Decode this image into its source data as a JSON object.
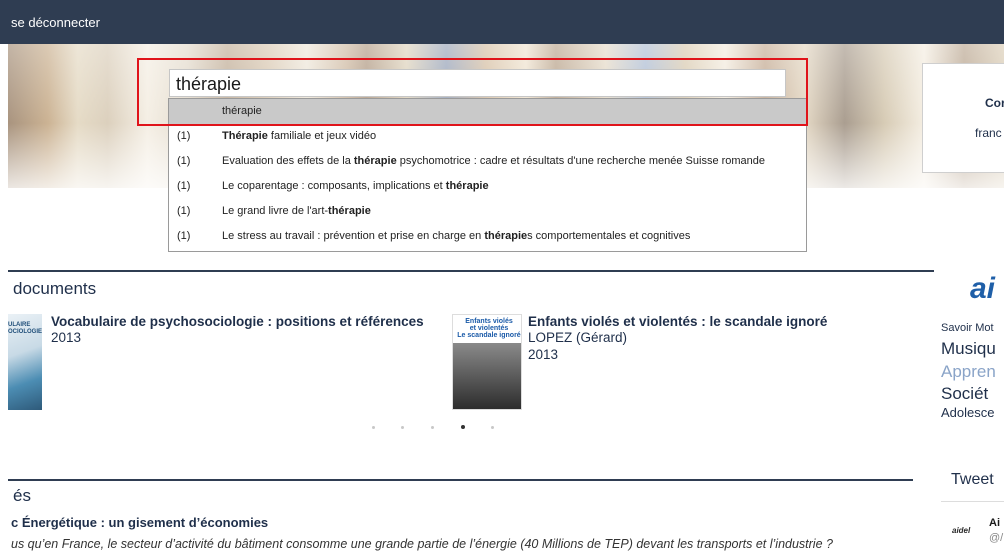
{
  "topbar": {
    "logout_label": "se déconnecter"
  },
  "banner": {
    "box_line1": "Cor",
    "box_line2": "franc"
  },
  "search": {
    "value": "thérapie",
    "suggestions": [
      {
        "count": "",
        "text": "thérapie",
        "active": true
      },
      {
        "count": "(1)",
        "text": "Thérapie familiale et jeux vidéo"
      },
      {
        "count": "(1)",
        "text": "Evaluation des effets de la thérapie psychomotrice : cadre et résultats d'une recherche menée Suisse romande"
      },
      {
        "count": "(1)",
        "text": "Le coparentage : composants, implications et thérapie"
      },
      {
        "count": "(1)",
        "text": "Le grand livre de l'art-thérapie"
      },
      {
        "count": "(1)",
        "text": "Le stress au travail : prévention et prise en charge en thérapies comportementales et cognitives"
      }
    ]
  },
  "documents": {
    "section_title": "documents",
    "items": [
      {
        "title": "Vocabulaire de psychosociologie : positions et références",
        "author": "",
        "year": "2013",
        "cover_text": "ULAIRE\nOCIOLOGIE"
      },
      {
        "title": "Enfants violés et violentés : le scandale ignoré",
        "author": "LOPEZ (Gérard)",
        "year": "2013",
        "cover_text": "Enfants violés\net violentés\nLe scandale ignoré"
      }
    ],
    "pager_count": 5,
    "pager_active": 3
  },
  "news": {
    "section_title": "és",
    "item_title": "c Énergétique : un gisement d’économies",
    "item_text": "us qu’en France, le secteur d’activité du bâtiment consomme une grande partie de l’énergie (40 Millions de TEP) devant les transports et l’industrie ?"
  },
  "sidebar": {
    "logo": "ai",
    "tags": [
      {
        "label": "Savoir Mot",
        "size": "small"
      },
      {
        "label": "Musiqu",
        "size": "large"
      },
      {
        "label": "Appren",
        "size": "large-light"
      },
      {
        "label": "Sociét",
        "size": "large"
      },
      {
        "label": "Adolesce",
        "size": "medium"
      }
    ],
    "tweets_title": "Tweet",
    "tweet": {
      "logo": "aidel",
      "name": "Ai",
      "handle": "@/"
    }
  },
  "colors": {
    "topbar": "#2f3d52",
    "accent_blue": "#1f5fa8",
    "highlight_red": "#e0141b"
  }
}
